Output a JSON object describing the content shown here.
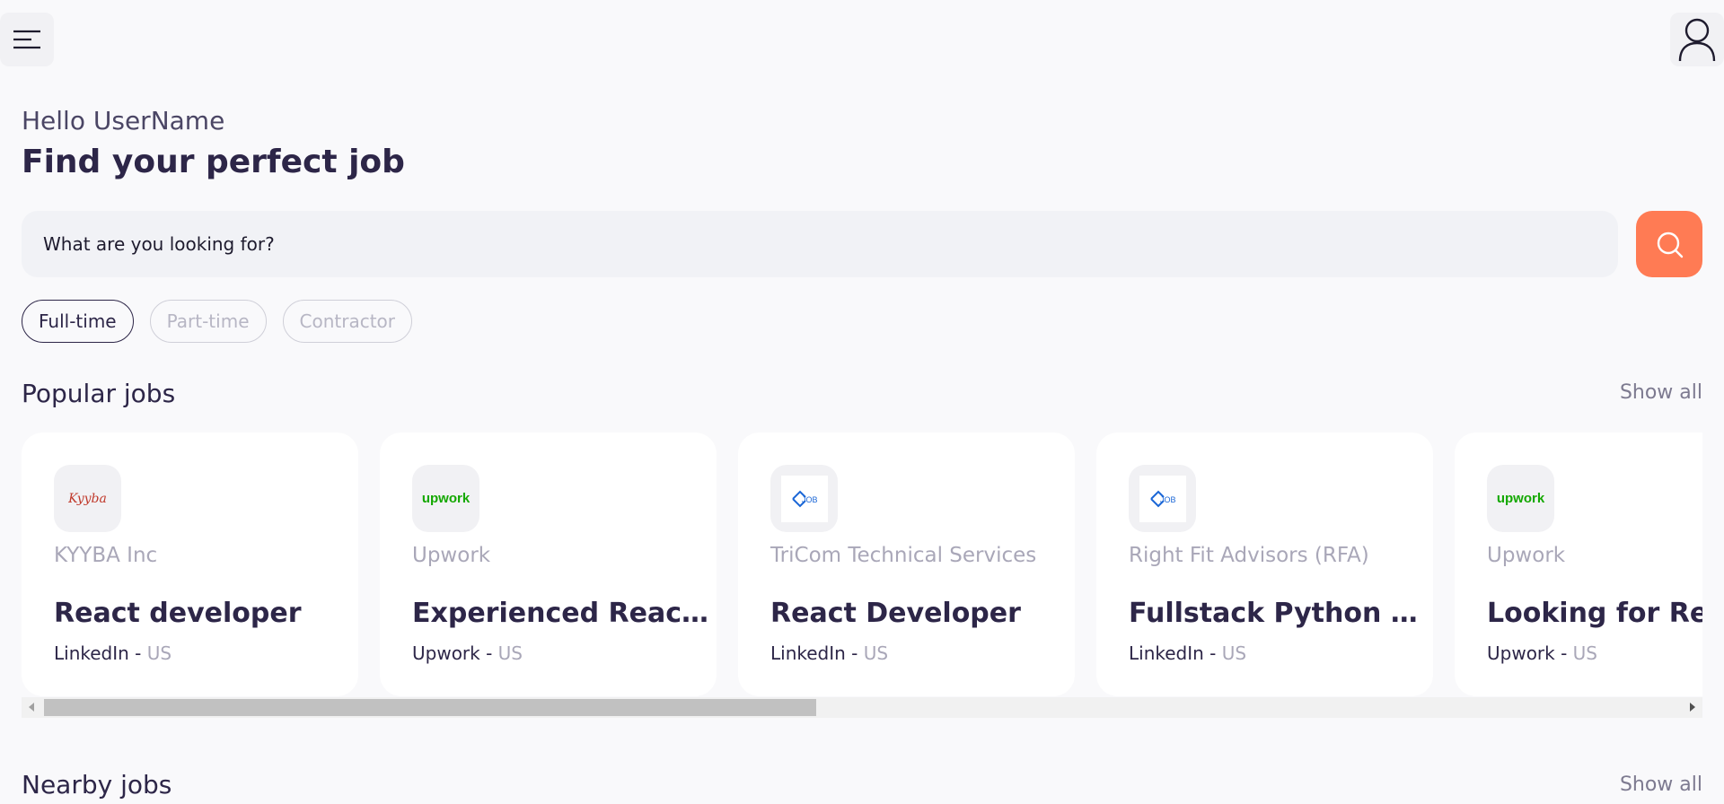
{
  "header": {
    "menu_icon": "hamburger-menu-icon",
    "profile_icon": "user-icon"
  },
  "greeting": "Hello UserName",
  "title": "Find your perfect job",
  "search": {
    "placeholder": "What are you looking for?",
    "button_icon": "search-icon",
    "button_color": "#ff7b54"
  },
  "filters": [
    {
      "label": "Full-time",
      "active": true
    },
    {
      "label": "Part-time",
      "active": false
    },
    {
      "label": "Contractor",
      "active": false
    }
  ],
  "popular": {
    "title": "Popular jobs",
    "show_all": "Show all",
    "jobs": [
      {
        "company": "KYYBA Inc",
        "title": "React developer",
        "source": "LinkedIn",
        "location": "US",
        "logo": "kyyba-logo",
        "logo_text": "Kyyba"
      },
      {
        "company": "Upwork",
        "title": "Experienced React Developer",
        "source": "Upwork",
        "location": "US",
        "logo": "upwork-logo",
        "logo_text": "upwork"
      },
      {
        "company": "TriCom Technical Services",
        "title": "React Developer",
        "source": "LinkedIn",
        "location": "US",
        "logo": "job-logo",
        "logo_text": "JOB"
      },
      {
        "company": "Right Fit Advisors (RFA)",
        "title": "Fullstack Python & React Developer",
        "source": "LinkedIn",
        "location": "US",
        "logo": "job-logo",
        "logo_text": "JOB"
      },
      {
        "company": "Upwork",
        "title": "Looking for React",
        "source": "Upwork",
        "location": "US",
        "logo": "upwork-logo",
        "logo_text": "upwork"
      }
    ]
  },
  "nearby": {
    "title": "Nearby jobs",
    "show_all": "Show all"
  },
  "separator": " - "
}
